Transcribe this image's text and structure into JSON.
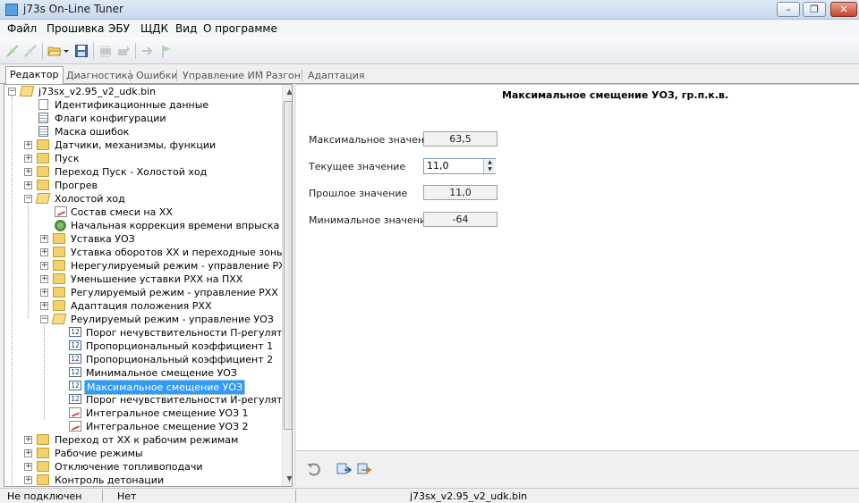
{
  "window": {
    "title": "j73s On-Line Tuner",
    "minimize": "–",
    "maximize": "❐",
    "close": "✕"
  },
  "menu": [
    "Файл",
    "Прошивка",
    "ЭБУ",
    "ЩДК",
    "Вид",
    "О программе"
  ],
  "tabs": [
    {
      "label": "Редактор",
      "active": true
    },
    {
      "label": "Диагностика"
    },
    {
      "label": "Ошибки"
    },
    {
      "label": "Управление ИМ"
    },
    {
      "label": "Разгон"
    },
    {
      "label": "Адаптация"
    }
  ],
  "tree": {
    "root": "j73sx_v2.95_v2_udk.bin",
    "items": [
      {
        "label": "Идентификационные данные",
        "icon": "doc-icon"
      },
      {
        "label": "Флаги конфигурации",
        "icon": "grid-icon"
      },
      {
        "label": "Маска ошибок",
        "icon": "grid-icon"
      },
      {
        "label": "Датчики, механизмы, функции",
        "icon": "folder-icon"
      },
      {
        "label": "Пуск",
        "icon": "folder-icon"
      },
      {
        "label": "Переход Пуск - Холостой ход",
        "icon": "folder-icon"
      },
      {
        "label": "Прогрев",
        "icon": "folder-icon"
      },
      {
        "label": "Холостой ход",
        "icon": "folder-open-icon"
      },
      {
        "label": "Состав смеси на ХХ",
        "icon": "chart-icon"
      },
      {
        "label": "Начальная коррекция времени впрыска ХХ",
        "icon": "gear-icon"
      },
      {
        "label": "Уставка УОЗ",
        "icon": "folder-icon"
      },
      {
        "label": "Уставка оборотов ХХ и переходные зоны",
        "icon": "folder-icon"
      },
      {
        "label": "Нерегулируемый режим - управление РХХ",
        "icon": "folder-icon"
      },
      {
        "label": "Уменьшение уставки РХХ на ПХХ",
        "icon": "folder-icon"
      },
      {
        "label": "Регулируемый режим - управление РХХ",
        "icon": "folder-icon"
      },
      {
        "label": "Адаптация положения РХХ",
        "icon": "folder-icon"
      },
      {
        "label": "Реулируемый режим - управление УОЗ",
        "icon": "folder-open-icon"
      },
      {
        "label": "Порог нечувствительности П-регулятора",
        "icon": "number-icon"
      },
      {
        "label": "Пропорциональный коэффициент 1",
        "icon": "number-icon"
      },
      {
        "label": "Пропорциональный коэффициент 2",
        "icon": "number-icon"
      },
      {
        "label": "Минимальное смещение УОЗ",
        "icon": "number-icon"
      },
      {
        "label": "Максимальное смещение УОЗ",
        "icon": "number-icon",
        "selected": true
      },
      {
        "label": "Порог нечувствительности И-регулятора",
        "icon": "number-icon"
      },
      {
        "label": "Интегральное смещение УОЗ 1",
        "icon": "chart-icon"
      },
      {
        "label": "Интегральное смещение УОЗ 2",
        "icon": "chart-icon"
      },
      {
        "label": "Переход от ХХ к рабочим режимам",
        "icon": "folder-icon"
      },
      {
        "label": "Рабочие режимы",
        "icon": "folder-icon"
      },
      {
        "label": "Отключение топливоподачи",
        "icon": "folder-icon"
      },
      {
        "label": "Контроль детонации",
        "icon": "folder-icon"
      }
    ]
  },
  "editor": {
    "title": "Максимальное смещение УОЗ, гр.п.к.в.",
    "fields": [
      {
        "label": "Максимальное значение",
        "value": "63,5"
      },
      {
        "label": "Текущее значение",
        "value": "11,0"
      },
      {
        "label": "Прошлое значение",
        "value": "11,0"
      },
      {
        "label": "Минимальное значение",
        "value": "-64"
      }
    ],
    "spin_up": "▲",
    "spin_down": "▼"
  },
  "status": {
    "connection": "Не подключен",
    "state": "Нет",
    "file": "j73sx_v2.95_v2_udk.bin"
  },
  "colors": {
    "selection": "#3399ff",
    "folder": "#f3d26b"
  }
}
